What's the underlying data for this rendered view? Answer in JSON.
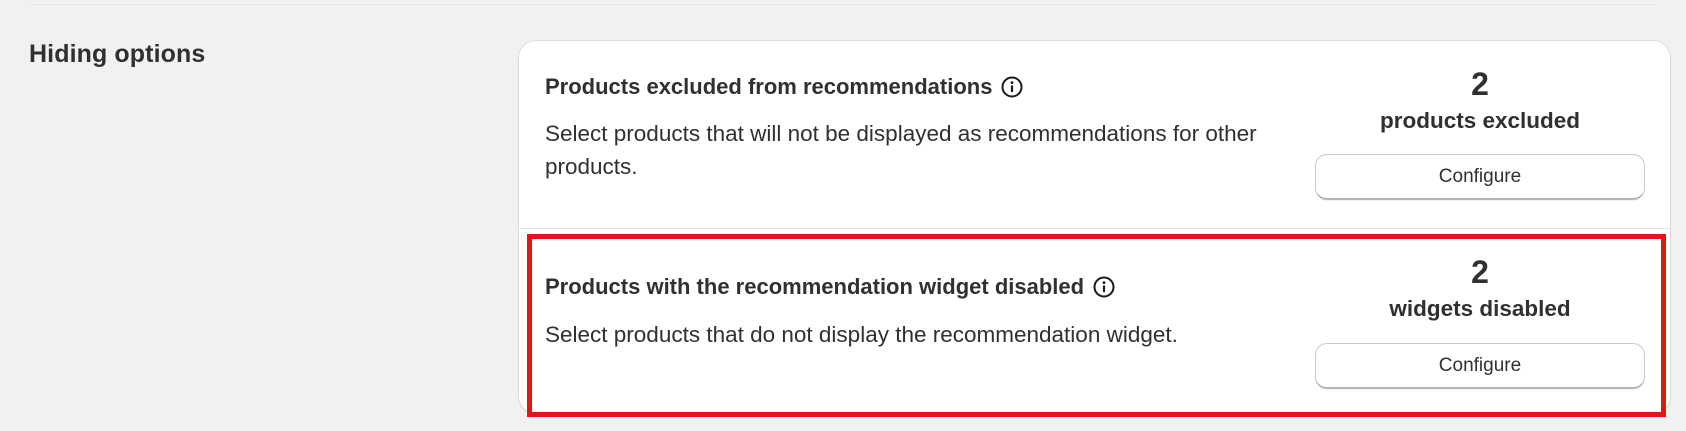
{
  "section": {
    "title": "Hiding options"
  },
  "rows": [
    {
      "title": "Products excluded from recommendations",
      "description": "Select products that will not be displayed as recommendations for other products.",
      "count": "2",
      "count_label": "products excluded",
      "button_label": "Configure",
      "highlighted": false
    },
    {
      "title": "Products with the recommendation widget disabled",
      "description": "Select products that do not display the recommendation widget.",
      "count": "2",
      "count_label": "widgets disabled",
      "button_label": "Configure",
      "highlighted": true
    }
  ],
  "colors": {
    "highlight_border": "#e0161a",
    "page_background": "#f1f1f1",
    "card_background": "#ffffff",
    "text": "#303030"
  },
  "icons": {
    "info": "info-circle-icon"
  }
}
